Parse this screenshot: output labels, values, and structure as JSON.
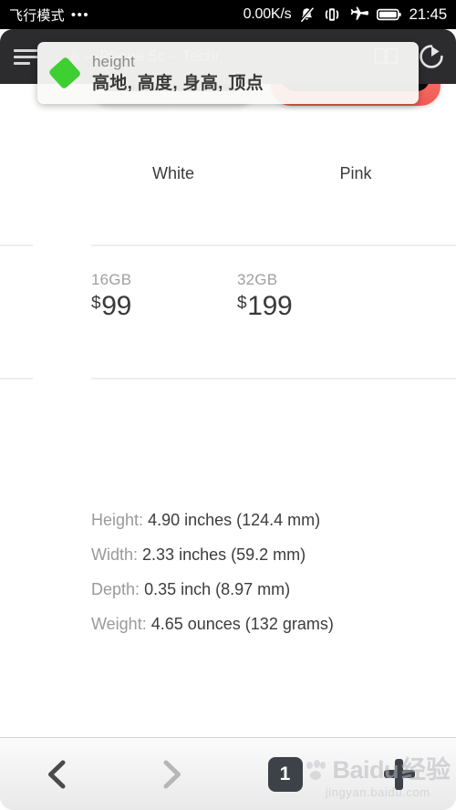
{
  "status_bar": {
    "carrier": "飞行模式",
    "dots": "•••",
    "network_speed": "0.00K/s",
    "time": "21:45",
    "icons": [
      "silent-bell-icon",
      "vibrate-icon",
      "airplane-mode-icon",
      "battery-icon"
    ]
  },
  "browser": {
    "menu_label": "menu",
    "page_title": "…e – iPhone 5c – Techr",
    "reader_label": "reader-mode",
    "reload_label": "reload"
  },
  "translate_popup": {
    "word": "height",
    "translation": "高地, 高度, 身高, 顶点",
    "accent_color": "#3ed030"
  },
  "page": {
    "colors": [
      {
        "name": "White",
        "swatch": "#e8e8e8"
      },
      {
        "name": "Pink",
        "swatch": "#f8675f"
      }
    ],
    "prices": [
      {
        "capacity": "16GB",
        "currency": "$",
        "amount": "99"
      },
      {
        "capacity": "32GB",
        "currency": "$",
        "amount": "199"
      }
    ],
    "specs": [
      {
        "label": "Height:",
        "value": "4.90 inches (124.4 mm)"
      },
      {
        "label": "Width:",
        "value": "2.33 inches (59.2 mm)"
      },
      {
        "label": "Depth:",
        "value": "0.35 inch (8.97 mm)"
      },
      {
        "label": "Weight:",
        "value": "4.65 ounces (132 grams)"
      }
    ]
  },
  "bottom_bar": {
    "back_label": "back",
    "forward_label": "forward",
    "tab_count": "1",
    "new_tab_label": "new-tab"
  },
  "watermark": {
    "brand": "Baidu",
    "cn": "经验",
    "url": "jingyan.baidu.com"
  }
}
